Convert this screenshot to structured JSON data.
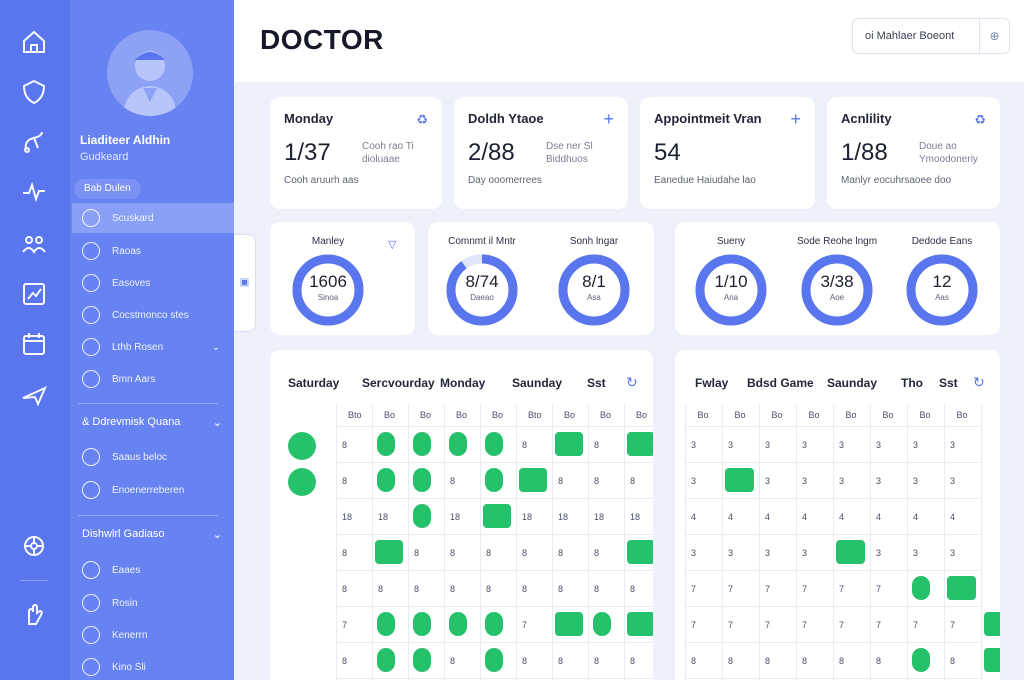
{
  "app": {
    "title": "DOCTOR"
  },
  "colors": {
    "accent": "#5a76ee",
    "sidebar": "#6783f1",
    "rail": "#5a76ee",
    "appointment": "#25c26b"
  },
  "rail": {
    "icons": [
      "home-icon",
      "shield-icon",
      "stethoscope-icon",
      "activity-icon",
      "team-icon",
      "chart-icon",
      "calendar-icon",
      "plane-icon",
      "settings-icon",
      "hand-icon"
    ]
  },
  "sidebar": {
    "user_name": "Liaditeer Aldhin",
    "user_role": "Gudkeard",
    "pill": "Bab Dulen",
    "items": [
      {
        "label": "Scuskard"
      },
      {
        "label": "Raoas"
      },
      {
        "label": "Easoves"
      },
      {
        "label": "Cocstmonco stes"
      },
      {
        "label": "Lthb Rosen"
      },
      {
        "label": "Bmn Aars"
      }
    ],
    "section1": {
      "title": "& Ddrevmisk Quana",
      "items": [
        {
          "label": "Saaus beloc"
        },
        {
          "label": "Enoenerreberen"
        }
      ]
    },
    "section2": {
      "title": "Dishwlrl Gadiaso",
      "items": [
        {
          "label": "Eaaes"
        },
        {
          "label": "Rosin"
        },
        {
          "label": "Kenerrn"
        },
        {
          "label": "Kino Sli"
        }
      ]
    }
  },
  "header": {
    "select_value": "oi Mahlaer Boeont",
    "select_icon": "⊕"
  },
  "stats": [
    {
      "title": "Monday",
      "value": "1/37",
      "aside": "Cooh rao  Ti dioluaae",
      "foot": "Cooh aruurh aas"
    },
    {
      "title": "Doldh Ytaoe",
      "value": "2/88",
      "aside": "Dse ner  Sl Biddhuos",
      "foot": "Day ooomerrees"
    },
    {
      "title": "Appointmeit Vran",
      "value": "54",
      "aside": "",
      "foot": "Eanedue Haiudahe lao"
    },
    {
      "title": "Acnlility",
      "value": "1/88",
      "aside": "Doue ao  Ymoodoneriy",
      "foot": "Manlyr eocuhrsaoee doo"
    }
  ],
  "gauges": [
    {
      "label": "Manley",
      "value": "1606",
      "sub": "Sinoa",
      "fraction": 1.0
    },
    {
      "label": "Comnmt il Mntr",
      "value": "8/74",
      "sub": "Daeao",
      "fraction": 0.9
    },
    {
      "label": "Sonh lngar",
      "value": "8/1",
      "sub": "Asa",
      "fraction": 1.0
    },
    {
      "label": "Sueny",
      "value": "1/10",
      "sub": "Ana",
      "fraction": 1.0
    },
    {
      "label": "Sode Reohe lngm",
      "value": "3/38",
      "sub": "Aoe",
      "fraction": 1.0
    },
    {
      "label": "Dedode Eans",
      "value": "12",
      "sub": "Aas",
      "fraction": 1.0
    }
  ],
  "schedule_left": {
    "headers": [
      "Saturday",
      "Sercvourday",
      "Monday",
      "Saunday",
      "Sst"
    ],
    "cols": [
      "Bto",
      "Bo",
      "Bo",
      "Bo",
      "Bo",
      "Bto",
      "Bo",
      "Bo",
      "Bo"
    ],
    "rows": [
      "8",
      "8",
      "18",
      "8",
      "8",
      "7",
      "8"
    ]
  },
  "schedule_right": {
    "headers": [
      "Fwlay",
      "Bdsd Game",
      "Saunday",
      "Tho",
      "Sst"
    ],
    "cols": [
      "Bo",
      "Bo",
      "Bo",
      "Bo",
      "Bo",
      "Bo",
      "Bo",
      "Bo"
    ],
    "rows": [
      "3",
      "3",
      "4",
      "3",
      "7",
      "7",
      "8"
    ]
  }
}
